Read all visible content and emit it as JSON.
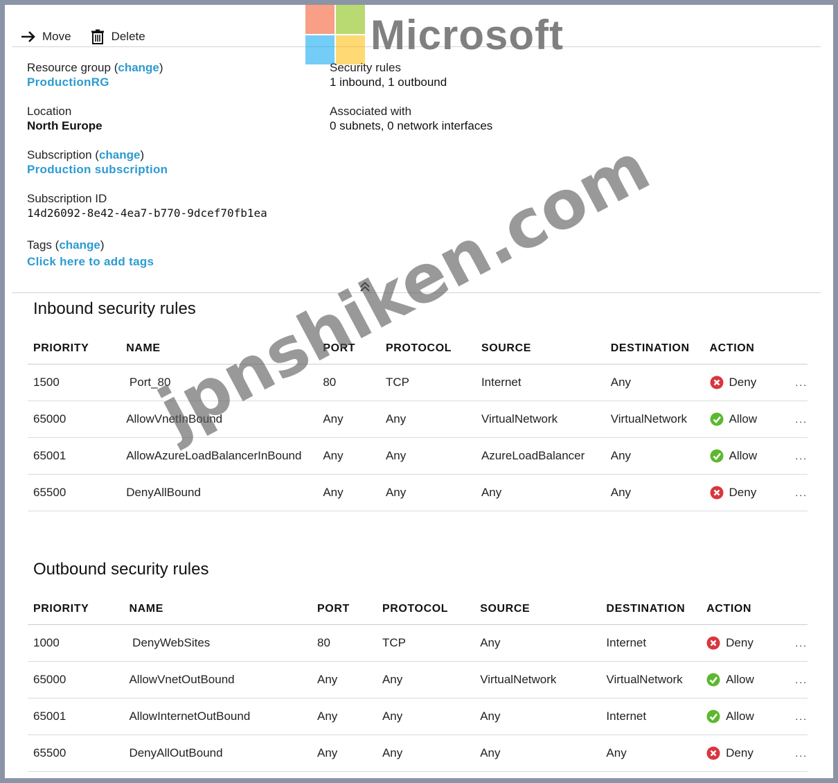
{
  "toolbar": {
    "move_label": "Move",
    "delete_label": "Delete"
  },
  "logo": {
    "text": "Microsoft"
  },
  "essentials": {
    "resource_group_label": "Resource group",
    "resource_group_value": "ProductionRG",
    "change_label": "change",
    "location_label": "Location",
    "location_value": "North Europe",
    "subscription_label": "Subscription",
    "subscription_value": "Production subscription",
    "subscription_id_label": "Subscription ID",
    "subscription_id_value": "14d26092-8e42-4ea7-b770-9dcef70fb1ea",
    "tags_label": "Tags",
    "tags_value": "Click here to add tags",
    "security_rules_label": "Security rules",
    "security_rules_value": "1 inbound, 1 outbound",
    "associated_label": "Associated with",
    "associated_value": "0 subnets, 0 network interfaces"
  },
  "columns": [
    "PRIORITY",
    "NAME",
    "PORT",
    "PROTOCOL",
    "SOURCE",
    "DESTINATION",
    "ACTION"
  ],
  "inbound": {
    "title": "Inbound security rules",
    "rows": [
      {
        "priority": "1500",
        "name": " Port_80",
        "port": "80",
        "protocol": "TCP",
        "source": "Internet",
        "destination": "Any",
        "action": "Deny"
      },
      {
        "priority": "65000",
        "name": "AllowVnetInBound",
        "port": "Any",
        "protocol": "Any",
        "source": "VirtualNetwork",
        "destination": "VirtualNetwork",
        "action": "Allow"
      },
      {
        "priority": "65001",
        "name": "AllowAzureLoadBalancerInBound",
        "port": "Any",
        "protocol": "Any",
        "source": "AzureLoadBalancer",
        "destination": "Any",
        "action": "Allow"
      },
      {
        "priority": "65500",
        "name": "DenyAllBound",
        "port": "Any",
        "protocol": "Any",
        "source": "Any",
        "destination": "Any",
        "action": "Deny"
      }
    ]
  },
  "outbound": {
    "title": "Outbound security rules",
    "rows": [
      {
        "priority": "1000",
        "name": " DenyWebSites",
        "port": "80",
        "protocol": "TCP",
        "source": "Any",
        "destination": "Internet",
        "action": "Deny"
      },
      {
        "priority": "65000",
        "name": "AllowVnetOutBound",
        "port": "Any",
        "protocol": "Any",
        "source": "VirtualNetwork",
        "destination": "VirtualNetwork",
        "action": "Allow"
      },
      {
        "priority": "65001",
        "name": "AllowInternetOutBound",
        "port": "Any",
        "protocol": "Any",
        "source": "Any",
        "destination": "Internet",
        "action": "Allow"
      },
      {
        "priority": "65500",
        "name": "DenyAllOutBound",
        "port": "Any",
        "protocol": "Any",
        "source": "Any",
        "destination": "Any",
        "action": "Deny"
      }
    ]
  },
  "row_menu": "...",
  "watermark": "jpnshiken.com",
  "colors": {
    "link": "#2b9bd1",
    "deny": "#d9363e",
    "allow": "#5cb82e"
  },
  "icons": {
    "move": "arrow-right-icon",
    "delete": "trash-icon",
    "deny": "deny-circle-x-icon",
    "allow": "allow-check-icon",
    "collapse": "chevron-double-up-icon"
  }
}
